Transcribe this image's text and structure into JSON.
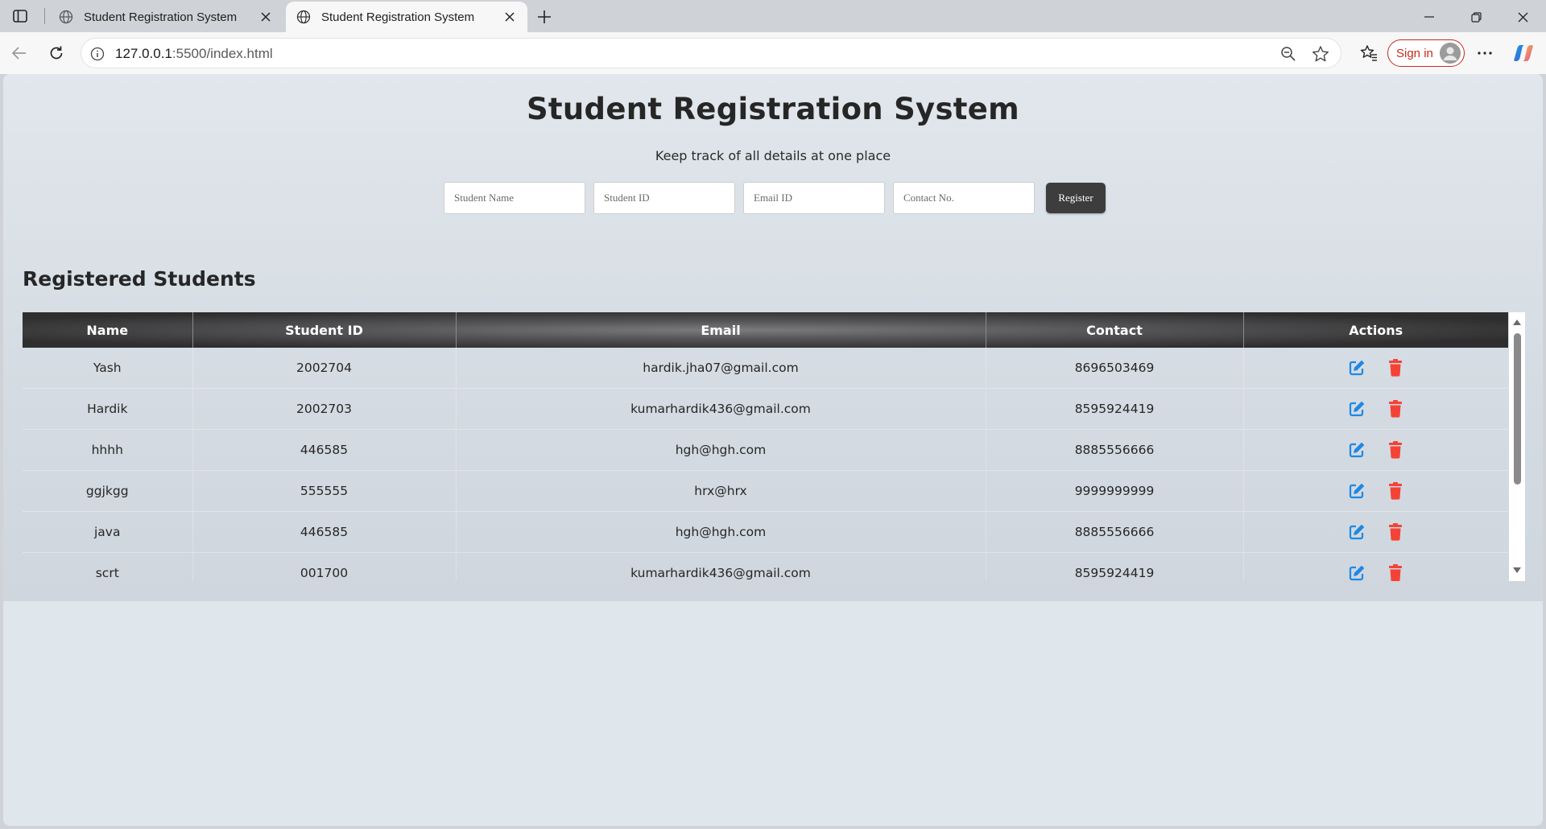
{
  "browser": {
    "tabs": [
      {
        "title": "Student Registration System",
        "icon": "globe-icon",
        "active": false
      },
      {
        "title": "Student Registration System",
        "icon": "globe-icon",
        "active": true
      }
    ],
    "address": {
      "host": "127.0.0.1",
      "path": ":5500/index.html"
    },
    "signin_label": "Sign in"
  },
  "page": {
    "title": "Student Registration System",
    "subtitle": "Keep track of all details at one place"
  },
  "form": {
    "name_placeholder": "Student Name",
    "id_placeholder": "Student ID",
    "email_placeholder": "Email ID",
    "contact_placeholder": "Contact No.",
    "register_label": "Register"
  },
  "students": {
    "heading": "Registered Students",
    "columns": [
      "Name",
      "Student ID",
      "Email",
      "Contact",
      "Actions"
    ],
    "rows": [
      {
        "name": "Yash",
        "id": "2002704",
        "email": "hardik.jha07@gmail.com",
        "contact": "8696503469"
      },
      {
        "name": "Hardik",
        "id": "2002703",
        "email": "kumarhardik436@gmail.com",
        "contact": "8595924419"
      },
      {
        "name": "hhhh",
        "id": "446585",
        "email": "hgh@hgh.com",
        "contact": "8885556666"
      },
      {
        "name": "ggjkgg",
        "id": "555555",
        "email": "hrx@hrx",
        "contact": "9999999999"
      },
      {
        "name": "java",
        "id": "446585",
        "email": "hgh@hgh.com",
        "contact": "8885556666"
      },
      {
        "name": "scrt",
        "id": "001700",
        "email": "kumarhardik436@gmail.com",
        "contact": "8595924419"
      }
    ],
    "action_icons": {
      "edit": "edit-icon",
      "delete": "trash-icon"
    }
  },
  "colors": {
    "accent_edit": "#1e88e5",
    "accent_delete": "#f44336",
    "header_dark": "#2e2e2e",
    "signin_red": "#c42b1c"
  }
}
